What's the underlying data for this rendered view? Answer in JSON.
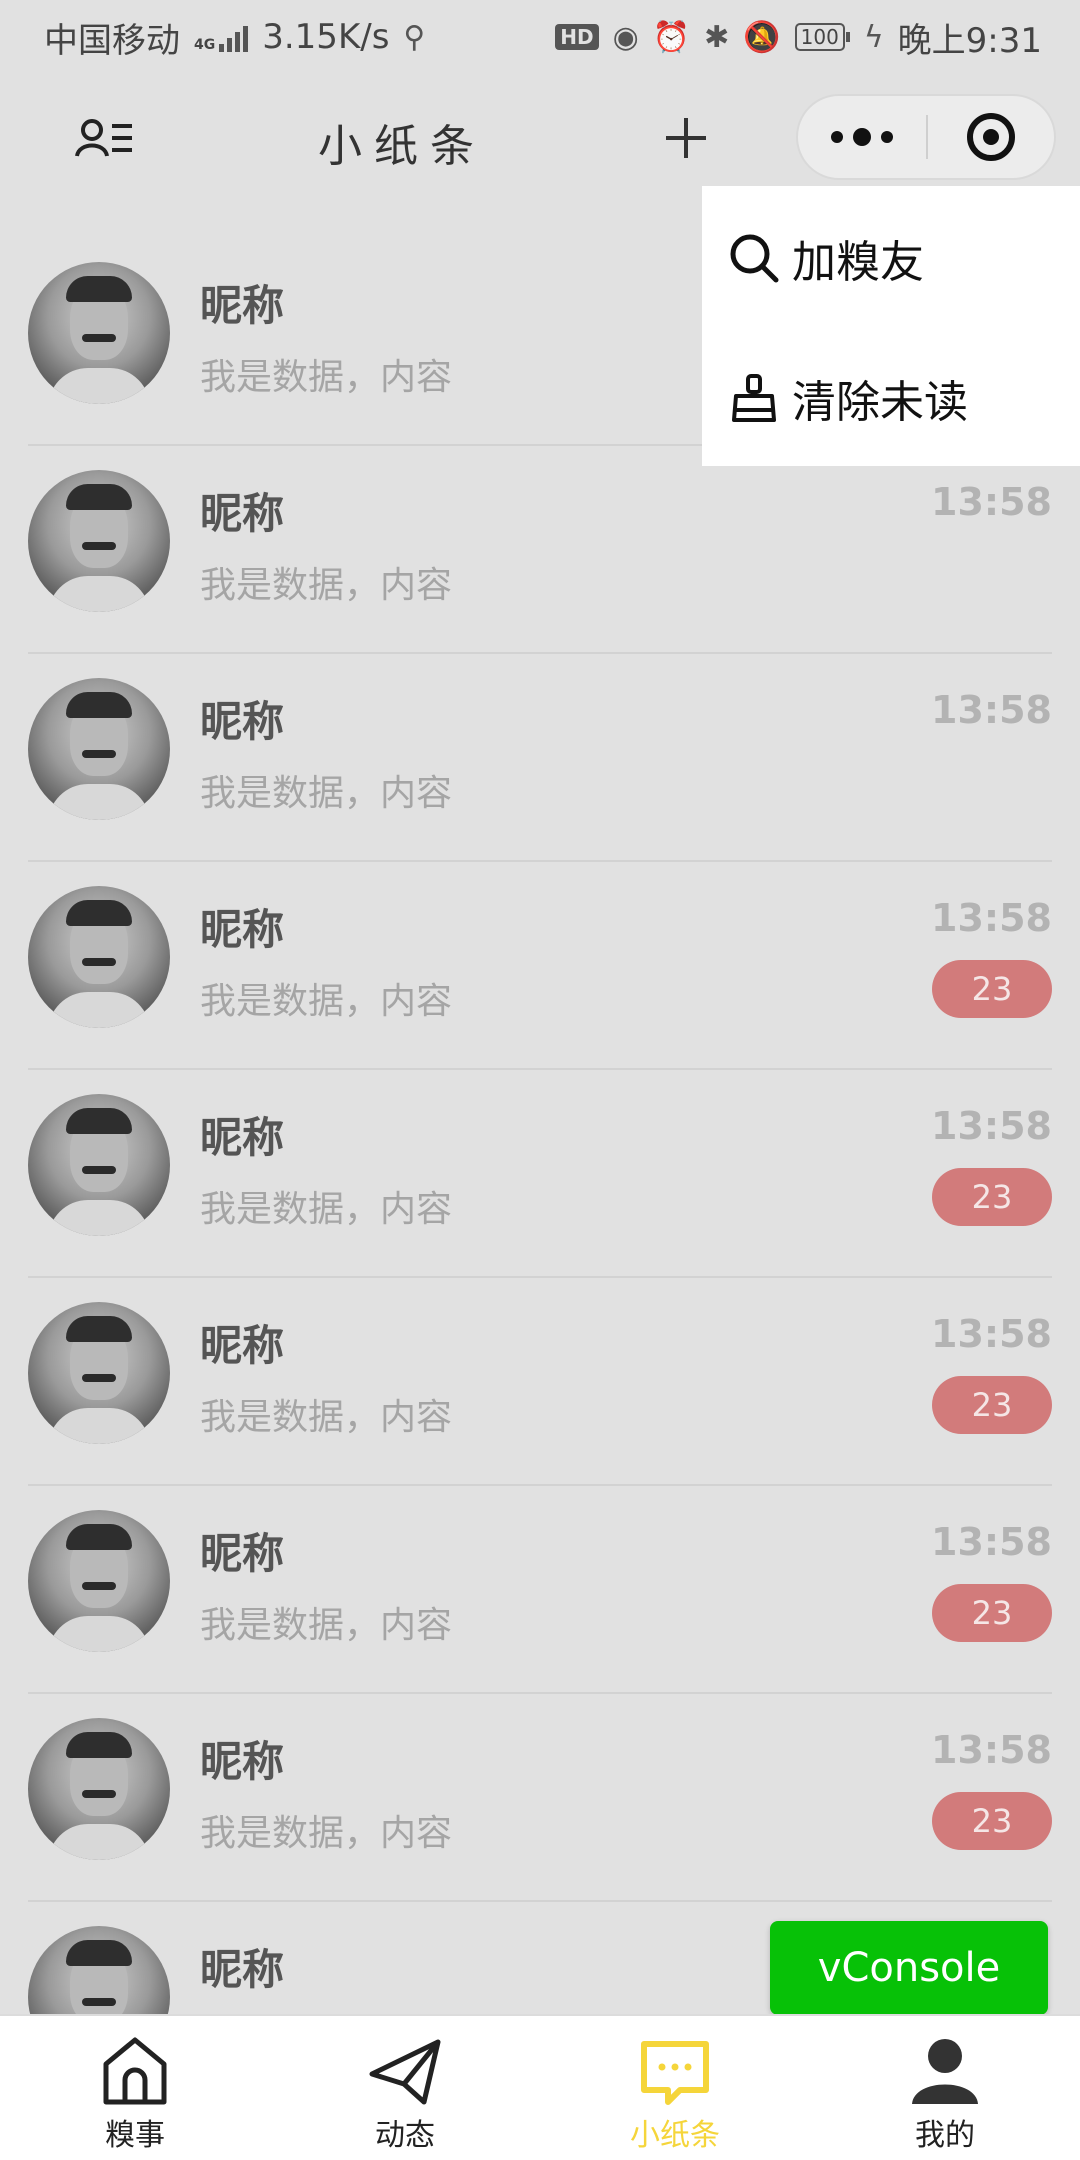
{
  "status_bar": {
    "carrier": "中国移动",
    "network": "4G",
    "speed": "3.15K/s",
    "usb_icon": "usb-icon",
    "hd_label": "HD",
    "eye_icon": "eye-icon",
    "alarm_icon": "alarm-icon",
    "bluetooth_icon": "bluetooth-icon",
    "mute_icon": "bell-off-icon",
    "battery": "100",
    "time": "晚上9:31"
  },
  "nav": {
    "title": "小纸条",
    "contacts_icon": "contacts-list-icon",
    "add_icon": "plus-icon",
    "more_icon": "more-dots-icon",
    "close_icon": "target-circle-icon"
  },
  "dropdown": {
    "items": [
      {
        "icon": "search-icon",
        "label": "加糗友"
      },
      {
        "icon": "broom-icon",
        "label": "清除未读"
      }
    ]
  },
  "conversations": [
    {
      "name": "昵称",
      "preview": "我是数据，内容",
      "time": "",
      "unread": ""
    },
    {
      "name": "昵称",
      "preview": "我是数据，内容",
      "time": "13:58",
      "unread": ""
    },
    {
      "name": "昵称",
      "preview": "我是数据，内容",
      "time": "13:58",
      "unread": ""
    },
    {
      "name": "昵称",
      "preview": "我是数据，内容",
      "time": "13:58",
      "unread": "23"
    },
    {
      "name": "昵称",
      "preview": "我是数据，内容",
      "time": "13:58",
      "unread": "23"
    },
    {
      "name": "昵称",
      "preview": "我是数据，内容",
      "time": "13:58",
      "unread": "23"
    },
    {
      "name": "昵称",
      "preview": "我是数据，内容",
      "time": "13:58",
      "unread": "23"
    },
    {
      "name": "昵称",
      "preview": "我是数据，内容",
      "time": "13:58",
      "unread": "23"
    },
    {
      "name": "昵称",
      "preview": "",
      "time": "",
      "unread": ""
    }
  ],
  "vconsole": {
    "label": "vConsole",
    "color": "#07c107"
  },
  "tab_bar": {
    "active_color": "#f5d53a",
    "tabs": [
      {
        "icon": "home-icon",
        "label": "糗事"
      },
      {
        "icon": "paper-plane-icon",
        "label": "动态"
      },
      {
        "icon": "chat-bubble-icon",
        "label": "小纸条",
        "active": true
      },
      {
        "icon": "user-icon",
        "label": "我的"
      }
    ]
  }
}
